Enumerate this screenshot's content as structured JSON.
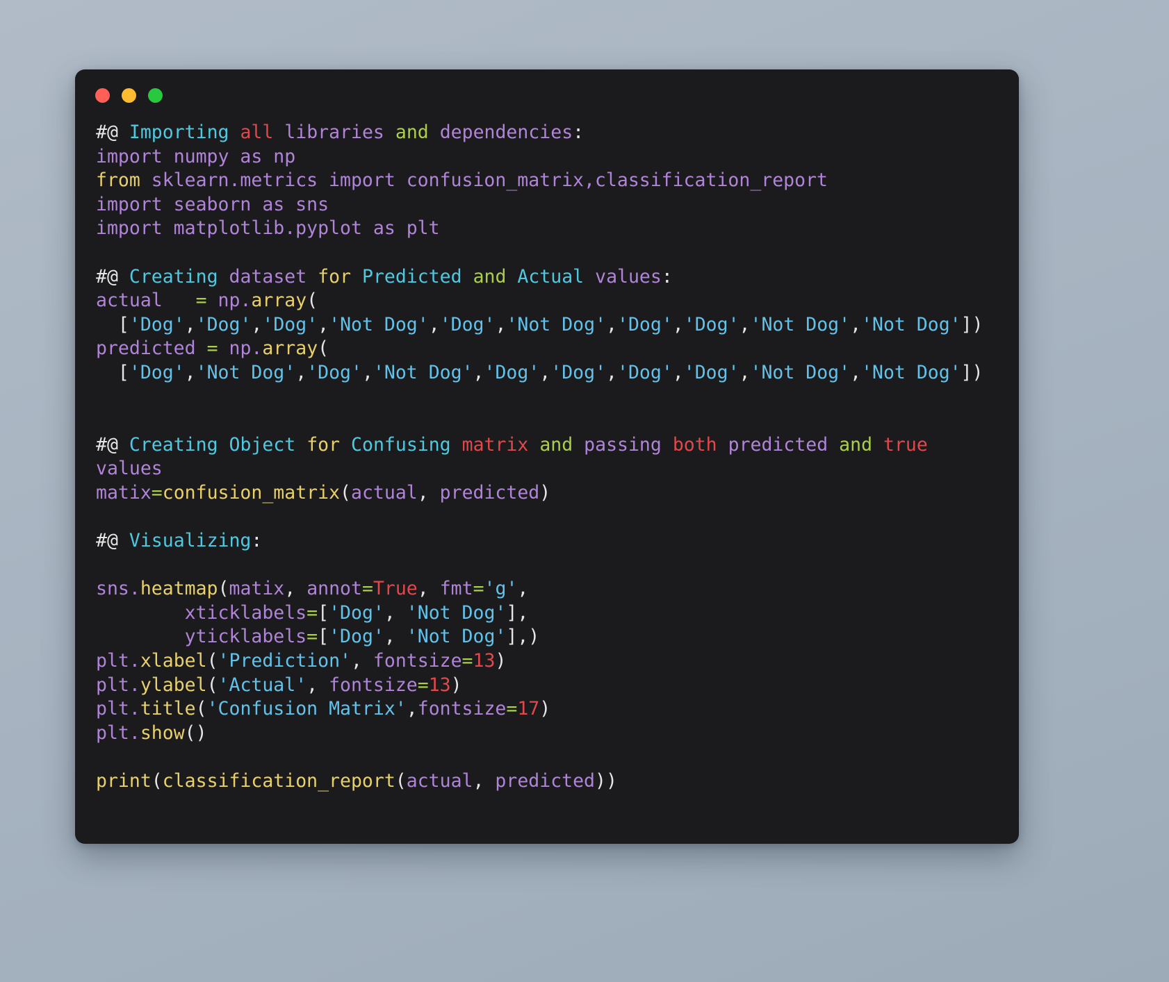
{
  "window": {
    "traffic_lights": [
      "close",
      "minimize",
      "maximize"
    ],
    "background_hex": "#1b1b1d",
    "desktop_hex": "#a9b5c2"
  },
  "theme": {
    "comment_marker": "#e6e6e6",
    "keyword": "#e8d06a",
    "identifier": "#b084d8",
    "string": "#62c2ea",
    "number": "#e2484b",
    "operator": "#aacf4a",
    "function": "#e8d06a",
    "highlight_cyan": "#4ec9e0",
    "highlight_red": "#e2484b",
    "highlight_green": "#aacf4a"
  },
  "code": {
    "language": "python",
    "lines": [
      {
        "id": 1,
        "tokens": [
          {
            "t": "#@",
            "c": "cmt"
          },
          {
            "t": " ",
            "c": "plain"
          },
          {
            "t": "Importing",
            "c": "cyan"
          },
          {
            "t": " ",
            "c": "plain"
          },
          {
            "t": "all",
            "c": "red"
          },
          {
            "t": " ",
            "c": "plain"
          },
          {
            "t": "libraries",
            "c": "pur"
          },
          {
            "t": " ",
            "c": "plain"
          },
          {
            "t": "and",
            "c": "grn"
          },
          {
            "t": " ",
            "c": "plain"
          },
          {
            "t": "dependencies",
            "c": "pur"
          },
          {
            "t": ":",
            "c": "plain"
          }
        ]
      },
      {
        "id": 2,
        "tokens": [
          {
            "t": "import",
            "c": "pur"
          },
          {
            "t": " numpy ",
            "c": "pur"
          },
          {
            "t": "as",
            "c": "pur"
          },
          {
            "t": " np",
            "c": "pur"
          }
        ]
      },
      {
        "id": 3,
        "tokens": [
          {
            "t": "from",
            "c": "yel"
          },
          {
            "t": " sklearn.metrics import confusion_matrix,classification_report",
            "c": "pur"
          }
        ]
      },
      {
        "id": 4,
        "tokens": [
          {
            "t": "import seaborn as sns",
            "c": "pur"
          }
        ]
      },
      {
        "id": 5,
        "tokens": [
          {
            "t": "import matplotlib.pyplot as plt",
            "c": "pur"
          }
        ]
      },
      {
        "id": 6,
        "tokens": []
      },
      {
        "id": 7,
        "tokens": [
          {
            "t": "#@",
            "c": "cmt"
          },
          {
            "t": " ",
            "c": "plain"
          },
          {
            "t": "Creating",
            "c": "cyan"
          },
          {
            "t": " ",
            "c": "plain"
          },
          {
            "t": "dataset",
            "c": "pur"
          },
          {
            "t": " ",
            "c": "plain"
          },
          {
            "t": "for",
            "c": "yel"
          },
          {
            "t": " ",
            "c": "plain"
          },
          {
            "t": "Predicted",
            "c": "cyan"
          },
          {
            "t": " ",
            "c": "plain"
          },
          {
            "t": "and",
            "c": "grn"
          },
          {
            "t": " ",
            "c": "plain"
          },
          {
            "t": "Actual",
            "c": "cyan"
          },
          {
            "t": " ",
            "c": "plain"
          },
          {
            "t": "values",
            "c": "pur"
          },
          {
            "t": ":",
            "c": "plain"
          }
        ]
      },
      {
        "id": 8,
        "tokens": [
          {
            "t": "actual",
            "c": "pur"
          },
          {
            "t": "   ",
            "c": "plain"
          },
          {
            "t": "=",
            "c": "eq"
          },
          {
            "t": " ",
            "c": "plain"
          },
          {
            "t": "np.",
            "c": "pur"
          },
          {
            "t": "array",
            "c": "yel"
          },
          {
            "t": "(",
            "c": "plain"
          }
        ]
      },
      {
        "id": 9,
        "tokens": [
          {
            "t": "  [",
            "c": "plain"
          },
          {
            "t": "'Dog'",
            "c": "str"
          },
          {
            "t": ",",
            "c": "plain"
          },
          {
            "t": "'Dog'",
            "c": "str"
          },
          {
            "t": ",",
            "c": "plain"
          },
          {
            "t": "'Dog'",
            "c": "str"
          },
          {
            "t": ",",
            "c": "plain"
          },
          {
            "t": "'Not Dog'",
            "c": "str"
          },
          {
            "t": ",",
            "c": "plain"
          },
          {
            "t": "'Dog'",
            "c": "str"
          },
          {
            "t": ",",
            "c": "plain"
          },
          {
            "t": "'Not Dog'",
            "c": "str"
          },
          {
            "t": ",",
            "c": "plain"
          },
          {
            "t": "'Dog'",
            "c": "str"
          },
          {
            "t": ",",
            "c": "plain"
          },
          {
            "t": "'Dog'",
            "c": "str"
          },
          {
            "t": ",",
            "c": "plain"
          },
          {
            "t": "'Not Dog'",
            "c": "str"
          },
          {
            "t": ",",
            "c": "plain"
          },
          {
            "t": "'Not Dog'",
            "c": "str"
          },
          {
            "t": "])",
            "c": "plain"
          }
        ]
      },
      {
        "id": 10,
        "tokens": [
          {
            "t": "predicted",
            "c": "pur"
          },
          {
            "t": " ",
            "c": "plain"
          },
          {
            "t": "=",
            "c": "eq"
          },
          {
            "t": " ",
            "c": "plain"
          },
          {
            "t": "np.",
            "c": "pur"
          },
          {
            "t": "array",
            "c": "yel"
          },
          {
            "t": "(",
            "c": "plain"
          }
        ]
      },
      {
        "id": 11,
        "tokens": [
          {
            "t": "  [",
            "c": "plain"
          },
          {
            "t": "'Dog'",
            "c": "str"
          },
          {
            "t": ",",
            "c": "plain"
          },
          {
            "t": "'Not Dog'",
            "c": "str"
          },
          {
            "t": ",",
            "c": "plain"
          },
          {
            "t": "'Dog'",
            "c": "str"
          },
          {
            "t": ",",
            "c": "plain"
          },
          {
            "t": "'Not Dog'",
            "c": "str"
          },
          {
            "t": ",",
            "c": "plain"
          },
          {
            "t": "'Dog'",
            "c": "str"
          },
          {
            "t": ",",
            "c": "plain"
          },
          {
            "t": "'Dog'",
            "c": "str"
          },
          {
            "t": ",",
            "c": "plain"
          },
          {
            "t": "'Dog'",
            "c": "str"
          },
          {
            "t": ",",
            "c": "plain"
          },
          {
            "t": "'Dog'",
            "c": "str"
          },
          {
            "t": ",",
            "c": "plain"
          },
          {
            "t": "'Not Dog'",
            "c": "str"
          },
          {
            "t": ",",
            "c": "plain"
          },
          {
            "t": "'Not Dog'",
            "c": "str"
          },
          {
            "t": "])",
            "c": "plain"
          }
        ]
      },
      {
        "id": 12,
        "tokens": []
      },
      {
        "id": 13,
        "tokens": []
      },
      {
        "id": 14,
        "tokens": [
          {
            "t": "#@",
            "c": "cmt"
          },
          {
            "t": " ",
            "c": "plain"
          },
          {
            "t": "Creating",
            "c": "cyan"
          },
          {
            "t": " ",
            "c": "plain"
          },
          {
            "t": "Object",
            "c": "cyan"
          },
          {
            "t": " ",
            "c": "plain"
          },
          {
            "t": "for",
            "c": "yel"
          },
          {
            "t": " ",
            "c": "plain"
          },
          {
            "t": "Confusing",
            "c": "cyan"
          },
          {
            "t": " ",
            "c": "plain"
          },
          {
            "t": "matrix",
            "c": "red"
          },
          {
            "t": " ",
            "c": "plain"
          },
          {
            "t": "and",
            "c": "grn"
          },
          {
            "t": " ",
            "c": "plain"
          },
          {
            "t": "passing",
            "c": "pur"
          },
          {
            "t": " ",
            "c": "plain"
          },
          {
            "t": "both",
            "c": "red"
          },
          {
            "t": " ",
            "c": "plain"
          },
          {
            "t": "predicted",
            "c": "pur"
          },
          {
            "t": " ",
            "c": "plain"
          },
          {
            "t": "and",
            "c": "grn"
          },
          {
            "t": " ",
            "c": "plain"
          },
          {
            "t": "true",
            "c": "red"
          }
        ]
      },
      {
        "id": 15,
        "tokens": [
          {
            "t": "values",
            "c": "pur"
          }
        ]
      },
      {
        "id": 16,
        "tokens": [
          {
            "t": "matix",
            "c": "pur"
          },
          {
            "t": "=",
            "c": "eq"
          },
          {
            "t": "confusion_matrix",
            "c": "yel"
          },
          {
            "t": "(",
            "c": "plain"
          },
          {
            "t": "actual",
            "c": "pur"
          },
          {
            "t": ", ",
            "c": "plain"
          },
          {
            "t": "predicted",
            "c": "pur"
          },
          {
            "t": ")",
            "c": "plain"
          }
        ]
      },
      {
        "id": 17,
        "tokens": []
      },
      {
        "id": 18,
        "tokens": [
          {
            "t": "#@",
            "c": "cmt"
          },
          {
            "t": " ",
            "c": "plain"
          },
          {
            "t": "Visualizing",
            "c": "cyan"
          },
          {
            "t": ":",
            "c": "plain"
          }
        ]
      },
      {
        "id": 19,
        "tokens": []
      },
      {
        "id": 20,
        "tokens": [
          {
            "t": "sns.",
            "c": "pur"
          },
          {
            "t": "heatmap",
            "c": "yel"
          },
          {
            "t": "(",
            "c": "plain"
          },
          {
            "t": "matix",
            "c": "pur"
          },
          {
            "t": ", ",
            "c": "plain"
          },
          {
            "t": "annot",
            "c": "pur"
          },
          {
            "t": "=",
            "c": "eq"
          },
          {
            "t": "True",
            "c": "red"
          },
          {
            "t": ", ",
            "c": "plain"
          },
          {
            "t": "fmt",
            "c": "pur"
          },
          {
            "t": "=",
            "c": "eq"
          },
          {
            "t": "'g'",
            "c": "str"
          },
          {
            "t": ",",
            "c": "plain"
          }
        ]
      },
      {
        "id": 21,
        "tokens": [
          {
            "t": "        ",
            "c": "plain"
          },
          {
            "t": "xticklabels",
            "c": "pur"
          },
          {
            "t": "=",
            "c": "eq"
          },
          {
            "t": "[",
            "c": "plain"
          },
          {
            "t": "'Dog'",
            "c": "str"
          },
          {
            "t": ", ",
            "c": "plain"
          },
          {
            "t": "'Not Dog'",
            "c": "str"
          },
          {
            "t": "],",
            "c": "plain"
          }
        ]
      },
      {
        "id": 22,
        "tokens": [
          {
            "t": "        ",
            "c": "plain"
          },
          {
            "t": "yticklabels",
            "c": "pur"
          },
          {
            "t": "=",
            "c": "eq"
          },
          {
            "t": "[",
            "c": "plain"
          },
          {
            "t": "'Dog'",
            "c": "str"
          },
          {
            "t": ", ",
            "c": "plain"
          },
          {
            "t": "'Not Dog'",
            "c": "str"
          },
          {
            "t": "],)",
            "c": "plain"
          }
        ]
      },
      {
        "id": 23,
        "tokens": [
          {
            "t": "plt.",
            "c": "pur"
          },
          {
            "t": "xlabel",
            "c": "yel"
          },
          {
            "t": "(",
            "c": "plain"
          },
          {
            "t": "'Prediction'",
            "c": "str"
          },
          {
            "t": ", ",
            "c": "plain"
          },
          {
            "t": "fontsize",
            "c": "pur"
          },
          {
            "t": "=",
            "c": "eq"
          },
          {
            "t": "13",
            "c": "num"
          },
          {
            "t": ")",
            "c": "plain"
          }
        ]
      },
      {
        "id": 24,
        "tokens": [
          {
            "t": "plt.",
            "c": "pur"
          },
          {
            "t": "ylabel",
            "c": "yel"
          },
          {
            "t": "(",
            "c": "plain"
          },
          {
            "t": "'Actual'",
            "c": "str"
          },
          {
            "t": ", ",
            "c": "plain"
          },
          {
            "t": "fontsize",
            "c": "pur"
          },
          {
            "t": "=",
            "c": "eq"
          },
          {
            "t": "13",
            "c": "num"
          },
          {
            "t": ")",
            "c": "plain"
          }
        ]
      },
      {
        "id": 25,
        "tokens": [
          {
            "t": "plt.",
            "c": "pur"
          },
          {
            "t": "title",
            "c": "yel"
          },
          {
            "t": "(",
            "c": "plain"
          },
          {
            "t": "'Confusion Matrix'",
            "c": "str"
          },
          {
            "t": ",",
            "c": "plain"
          },
          {
            "t": "fontsize",
            "c": "pur"
          },
          {
            "t": "=",
            "c": "eq"
          },
          {
            "t": "17",
            "c": "num"
          },
          {
            "t": ")",
            "c": "plain"
          }
        ]
      },
      {
        "id": 26,
        "tokens": [
          {
            "t": "plt.",
            "c": "pur"
          },
          {
            "t": "show",
            "c": "yel"
          },
          {
            "t": "()",
            "c": "plain"
          }
        ]
      },
      {
        "id": 27,
        "tokens": []
      },
      {
        "id": 28,
        "tokens": [
          {
            "t": "print",
            "c": "yel"
          },
          {
            "t": "(",
            "c": "plain"
          },
          {
            "t": "classification_report",
            "c": "yel"
          },
          {
            "t": "(",
            "c": "plain"
          },
          {
            "t": "actual",
            "c": "pur"
          },
          {
            "t": ", ",
            "c": "plain"
          },
          {
            "t": "predicted",
            "c": "pur"
          },
          {
            "t": "))",
            "c": "plain"
          }
        ]
      }
    ]
  }
}
